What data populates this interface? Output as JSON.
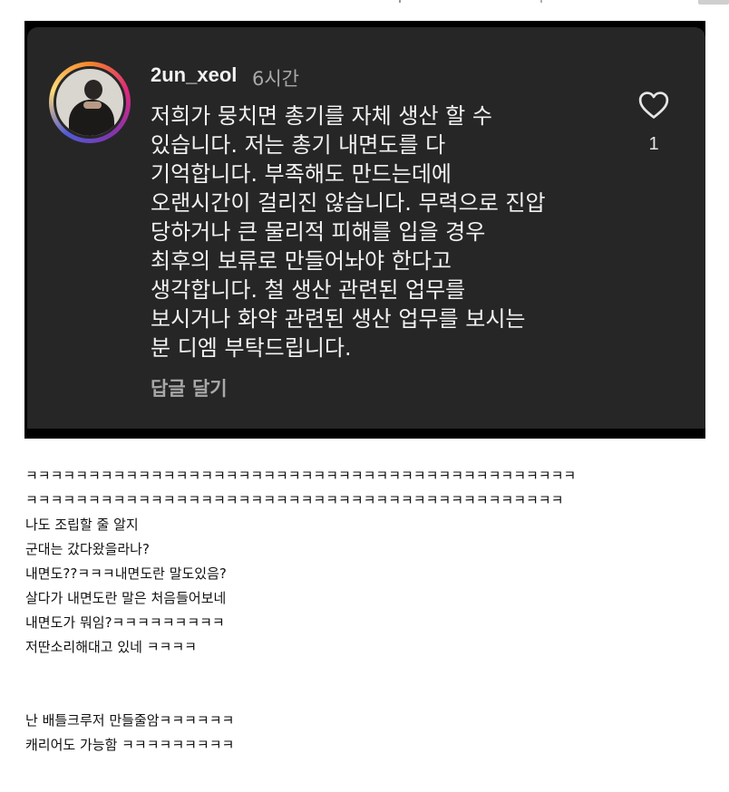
{
  "comment_card": {
    "username": "2un_xeol",
    "time": "6시간",
    "lines": [
      "저희가 뭉치면 총기를 자체 생산 할 수",
      "있습니다. 저는 총기 내면도를 다",
      "기억합니다. 부족해도 만드는데에",
      "오랜시간이 걸리진 않습니다. 무력으로 진압",
      "당하거나 큰 물리적 피해를 입을 경우",
      "최후의 보류로 만들어놔야 한다고",
      "생각합니다. 철 생산 관련된 업무를",
      "보시거나 화약 관련된 생산 업무를 보시는",
      "분 디엠 부탁드립니다."
    ],
    "reply_label": "답글 달기",
    "like_count": "1",
    "heart_icon": "heart-outline-icon",
    "avatar_icon": "profile-avatar"
  },
  "post_text": {
    "lines": [
      "ㅋㅋㅋㅋㅋㅋㅋㅋㅋㅋㅋㅋㅋㅋㅋㅋㅋㅋㅋㅋㅋㅋㅋㅋㅋㅋㅋㅋㅋㅋㅋㅋㅋㅋㅋㅋㅋㅋㅋㅋㅋㅋㅋㅋ",
      "ㅋㅋㅋㅋㅋㅋㅋㅋㅋㅋㅋㅋㅋㅋㅋㅋㅋㅋㅋㅋㅋㅋㅋㅋㅋㅋㅋㅋㅋㅋㅋㅋㅋㅋㅋㅋㅋㅋㅋㅋㅋㅋㅋ",
      "나도 조립할 줄 알지",
      "군대는 갔다왔을라나?",
      "내면도??ㅋㅋㅋ내면도란 말도있음?",
      "살다가 내면도란 말은 처음들어보네",
      "내면도가 뭐임?ㅋㅋㅋㅋㅋㅋㅋㅋㅋ",
      "저딴소리해대고 있네 ㅋㅋㅋㅋ",
      "",
      "",
      "난 배틀크루저 만들줄암ㅋㅋㅋㅋㅋㅋ",
      "캐리어도 가능함 ㅋㅋㅋㅋㅋㅋㅋㅋㅋ"
    ]
  },
  "colors": {
    "card_background": "#262626",
    "frame_background": "#000000",
    "text_primary": "#f2f2f2",
    "text_secondary": "#a8a8a8",
    "page_background": "#ffffff"
  }
}
